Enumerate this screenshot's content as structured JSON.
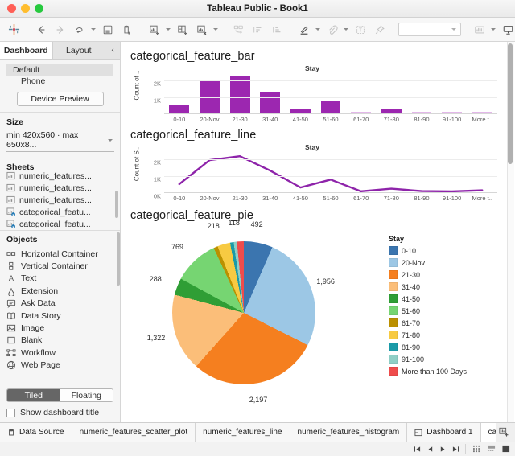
{
  "window": {
    "title": "Tableau Public - Book1"
  },
  "toolbar": {
    "icons": [
      "tableau-logo-icon",
      "back-icon",
      "forward-icon",
      "undo-redo-icon",
      "save-icon",
      "new-data-source-icon",
      "new-worksheet-icon",
      "new-dashboard-icon",
      "new-story-icon",
      "clear-sheet-icon",
      "duplicate-icon",
      "swap-rows-cols-icon",
      "sort-ascending-icon",
      "sort-descending-icon",
      "highlight-icon",
      "attachment-icon",
      "text-icon",
      "pin-icon",
      "fit-dropdown",
      "show-me-icon",
      "presentation-mode-icon",
      "overflow-icon"
    ],
    "overflow_label": "»"
  },
  "sidebar": {
    "tabs": [
      {
        "label": "Dashboard",
        "active": true
      },
      {
        "label": "Layout",
        "active": false
      }
    ],
    "collapse_label": "‹",
    "device": {
      "items": [
        {
          "label": "Default",
          "selected": true
        },
        {
          "label": "Phone",
          "selected": false
        }
      ],
      "preview_button": "Device Preview"
    },
    "size": {
      "title": "Size",
      "value": "min 420x560 · max 650x8..."
    },
    "sheets": {
      "title": "Sheets",
      "items": [
        {
          "label": "numeric_features...",
          "icon": "worksheet-icon",
          "used": false
        },
        {
          "label": "numeric_features...",
          "icon": "worksheet-icon",
          "used": false
        },
        {
          "label": "numeric_features...",
          "icon": "worksheet-icon",
          "used": false
        },
        {
          "label": "categorical_featu...",
          "icon": "worksheet-used-icon",
          "used": true
        },
        {
          "label": "categorical_featu...",
          "icon": "worksheet-used-icon",
          "used": true
        },
        {
          "label": "categorical_featu...",
          "icon": "worksheet-used-icon",
          "used": true
        }
      ]
    },
    "objects": {
      "title": "Objects",
      "items": [
        {
          "label": "Horizontal Container",
          "icon": "horizontal-container-icon"
        },
        {
          "label": "Vertical Container",
          "icon": "vertical-container-icon"
        },
        {
          "label": "Text",
          "icon": "text-icon"
        },
        {
          "label": "Extension",
          "icon": "extension-icon"
        },
        {
          "label": "Ask Data",
          "icon": "ask-data-icon"
        },
        {
          "label": "Data Story",
          "icon": "data-story-icon"
        },
        {
          "label": "Image",
          "icon": "image-icon"
        },
        {
          "label": "Blank",
          "icon": "blank-icon"
        },
        {
          "label": "Workflow",
          "icon": "workflow-icon"
        },
        {
          "label": "Web Page",
          "icon": "web-page-icon"
        }
      ]
    },
    "layout_toggle": {
      "tiled": "Tiled",
      "floating": "Floating",
      "active": "Tiled"
    },
    "show_title": {
      "label": "Show dashboard title",
      "checked": false
    }
  },
  "dashboard": {
    "panels": [
      {
        "title": "categorical_feature_bar"
      },
      {
        "title": "categorical_feature_line"
      },
      {
        "title": "categorical_feature_pie"
      }
    ]
  },
  "chart_data": [
    {
      "type": "bar",
      "title": "categorical_feature_bar",
      "header": "Stay",
      "ylabel": "Count of ..",
      "xlabel": "",
      "categories": [
        "0-10",
        "20-Nov",
        "21-30",
        "31-40",
        "41-50",
        "51-60",
        "61-70",
        "71-80",
        "81-90",
        "91-100",
        "More t.."
      ],
      "values": [
        492,
        1956,
        2197,
        1322,
        288,
        769,
        60,
        218,
        70,
        55,
        118
      ],
      "ylim": [
        0,
        2500
      ],
      "yticks": [
        1000,
        2000
      ],
      "yticklabels": [
        "1K",
        "2K"
      ],
      "color": "#9c27b0",
      "grid": true
    },
    {
      "type": "line",
      "title": "categorical_feature_line",
      "header": "Stay",
      "ylabel": "Count of S..",
      "xlabel": "",
      "categories": [
        "0-10",
        "20-Nov",
        "21-30",
        "31-40",
        "41-50",
        "51-60",
        "61-70",
        "71-80",
        "81-90",
        "91-100",
        "More t.."
      ],
      "values": [
        492,
        1956,
        2197,
        1322,
        288,
        769,
        60,
        218,
        70,
        55,
        118
      ],
      "ylim": [
        0,
        2500
      ],
      "yticks": [
        0,
        1000,
        2000
      ],
      "yticklabels": [
        "0K",
        "1K",
        "2K"
      ],
      "color": "#8e24aa",
      "grid": true
    },
    {
      "type": "pie",
      "title": "categorical_feature_pie",
      "legend_title": "Stay",
      "legend_position": "right",
      "labels": [
        "0-10",
        "20-Nov",
        "21-30",
        "31-40",
        "41-50",
        "51-60",
        "61-70",
        "71-80",
        "81-90",
        "91-100",
        "More than 100 Days"
      ],
      "values": [
        492,
        1956,
        2197,
        1322,
        288,
        769,
        70,
        218,
        60,
        55,
        118
      ],
      "visible_labels": [
        "492",
        "1,956",
        "2,197",
        "1,322",
        "288",
        "769",
        "218",
        "118"
      ],
      "colors": [
        "#3b75af",
        "#9cc7e5",
        "#f57f1f",
        "#fbbe79",
        "#2f9e35",
        "#76d572",
        "#bb9000",
        "#f7ca42",
        "#1a9aa8",
        "#8fcfc6",
        "#ef4c4c"
      ]
    }
  ],
  "statusbar": {
    "tabs": [
      {
        "label": "Data Source",
        "icon": "data-source-icon",
        "active": false
      },
      {
        "label": "numeric_features_scatter_plot",
        "icon": "",
        "active": false
      },
      {
        "label": "numeric_features_line",
        "icon": "",
        "active": false
      },
      {
        "label": "numeric_features_histogram",
        "icon": "",
        "active": false
      },
      {
        "label": "Dashboard 1",
        "icon": "dashboard-icon",
        "active": false
      },
      {
        "label": "categor",
        "icon": "",
        "active": true
      }
    ],
    "add_buttons": [
      "new-worksheet-icon",
      "new-dashboard-icon",
      "new-story-icon"
    ],
    "nav_buttons": [
      "first-page-icon",
      "previous-page-icon",
      "next-page-icon",
      "last-page-icon"
    ],
    "view_buttons": [
      "show-filmstrip-icon",
      "show-sheet-sorter-icon",
      "show-sheet-icon"
    ]
  }
}
